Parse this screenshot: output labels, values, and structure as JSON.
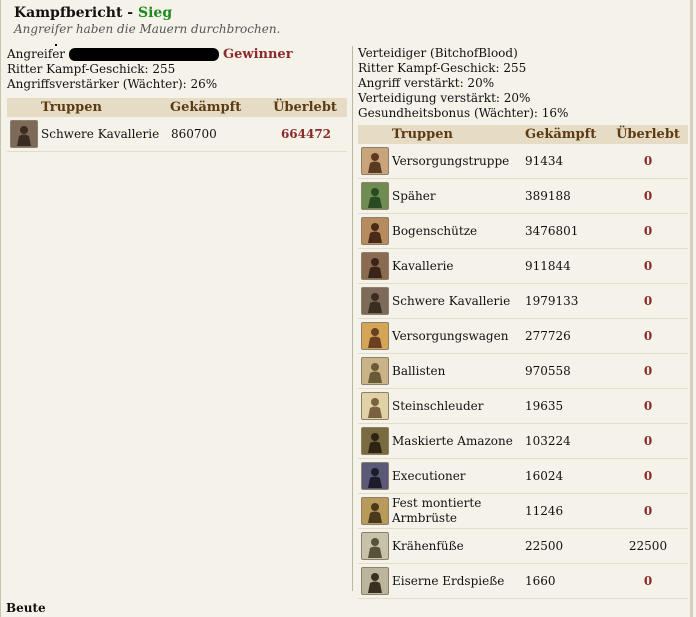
{
  "header": {
    "title": "Kampfbericht - ",
    "result": "Sieg",
    "subtitle": "Angreifer haben die Mauern durchbrochen."
  },
  "attacker": {
    "label": "Angreifer",
    "winner": "Gewinner",
    "skill": "Ritter Kampf-Geschick: 255",
    "booster": "Angriffsverstärker (Wächter): 26%",
    "columns": [
      "Truppen",
      "Gekämpft",
      "Überlebt"
    ],
    "rows": [
      {
        "name": "Schwere Kavallerie",
        "fought": "860700",
        "survived": "664472",
        "icon": "heavy-cavalry-icon"
      }
    ]
  },
  "defender": {
    "label": "Verteidiger (BitchofBlood)",
    "skill": "Ritter Kampf-Geschick: 255",
    "attack_boost": "Angriff verstärkt: 20%",
    "defense_boost": "Verteidigung verstärkt: 20%",
    "health_bonus": "Gesundheitsbonus (Wächter): 16%",
    "columns": [
      "Truppen",
      "Gekämpft",
      "Überlebt"
    ],
    "rows": [
      {
        "name": "Versorgungstruppe",
        "fought": "91434",
        "survived": "0",
        "icon": "supply-troop-icon"
      },
      {
        "name": "Späher",
        "fought": "389188",
        "survived": "0",
        "icon": "scout-icon"
      },
      {
        "name": "Bogenschütze",
        "fought": "3476801",
        "survived": "0",
        "icon": "archer-icon"
      },
      {
        "name": "Kavallerie",
        "fought": "911844",
        "survived": "0",
        "icon": "cavalry-icon"
      },
      {
        "name": "Schwere Kavallerie",
        "fought": "1979133",
        "survived": "0",
        "icon": "heavy-cavalry-icon"
      },
      {
        "name": "Versorgungswagen",
        "fought": "277726",
        "survived": "0",
        "icon": "supply-wagon-icon"
      },
      {
        "name": "Ballisten",
        "fought": "970558",
        "survived": "0",
        "icon": "ballista-icon"
      },
      {
        "name": "Steinschleuder",
        "fought": "19635",
        "survived": "0",
        "icon": "catapult-icon"
      },
      {
        "name": "Maskierte Amazone",
        "fought": "103224",
        "survived": "0",
        "icon": "amazon-icon"
      },
      {
        "name": "Executioner",
        "fought": "16024",
        "survived": "0",
        "icon": "executioner-icon"
      },
      {
        "name": "Fest montierte Armbrüste",
        "fought": "11246",
        "survived": "0",
        "icon": "crossbow-icon"
      },
      {
        "name": "Krähenfüße",
        "fought": "22500",
        "survived": "22500",
        "icon": "caltrops-icon"
      },
      {
        "name": "Eiserne Erdspieße",
        "fought": "1660",
        "survived": "0",
        "icon": "spikes-icon"
      }
    ]
  },
  "footer": {
    "loot": "Beute"
  },
  "colors": {
    "win": "#1e8a1e",
    "winner": "#8b2a2a",
    "header_bg": "#e6dcc6",
    "header_text": "#5c3a12"
  }
}
